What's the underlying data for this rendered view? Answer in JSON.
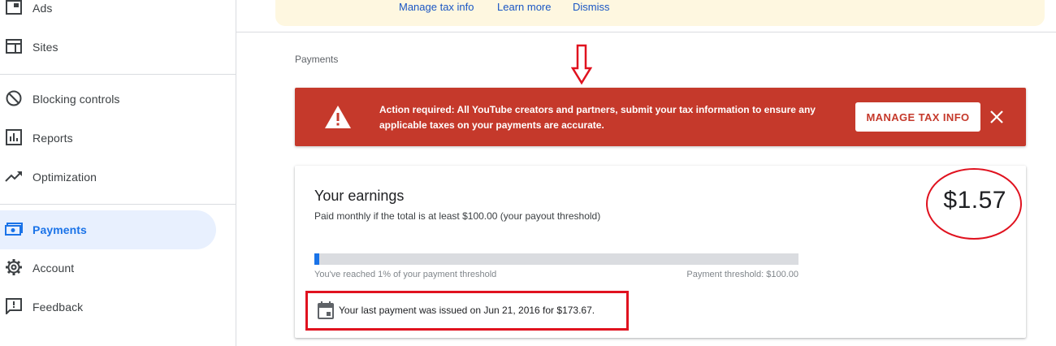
{
  "sidebar": {
    "items": [
      {
        "label": "Ads",
        "icon": "ads-icon"
      },
      {
        "label": "Sites",
        "icon": "sites-icon"
      },
      {
        "label": "Blocking controls",
        "icon": "blocking-icon"
      },
      {
        "label": "Reports",
        "icon": "reports-icon"
      },
      {
        "label": "Optimization",
        "icon": "optimization-icon"
      },
      {
        "label": "Payments",
        "icon": "payments-icon",
        "active": true
      },
      {
        "label": "Account",
        "icon": "gear-icon"
      },
      {
        "label": "Feedback",
        "icon": "feedback-icon"
      }
    ]
  },
  "notice": {
    "links": [
      "Manage tax info",
      "Learn more",
      "Dismiss"
    ]
  },
  "page": {
    "heading": "Payments"
  },
  "alert": {
    "text": "Action required: All YouTube creators and partners, submit your tax information to ensure any applicable taxes on your payments are accurate.",
    "button_label": "MANAGE TAX INFO"
  },
  "earnings": {
    "title": "Your earnings",
    "subtitle": "Paid monthly if the total is at least $100.00 (your payout threshold)",
    "amount": "$1.57",
    "progress_percent": 1,
    "progress_text": "You've reached 1% of your payment threshold",
    "threshold_text": "Payment threshold: $100.00",
    "last_payment": "Your last payment was issued on Jun 21, 2016 for $173.67."
  },
  "colors": {
    "accent": "#1a73e8",
    "alert": "#c5392b",
    "annotation": "#e0121f",
    "notice_bg": "#fef7e0"
  }
}
